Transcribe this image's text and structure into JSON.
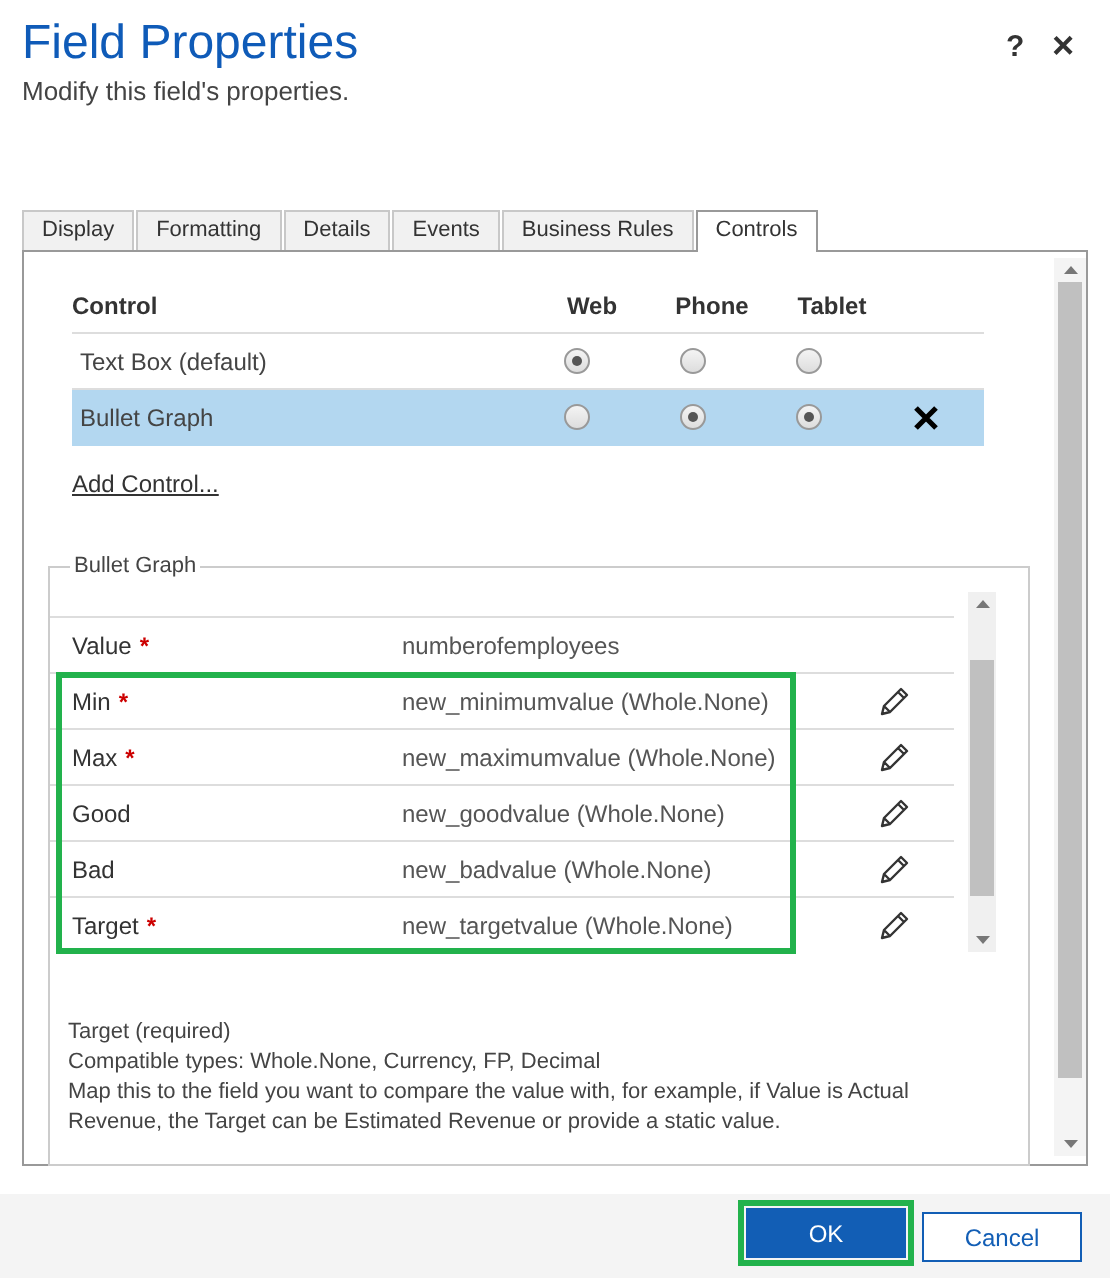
{
  "dialog": {
    "title": "Field Properties",
    "subtitle": "Modify this field's properties.",
    "help_button": "?",
    "close_button": "×"
  },
  "tabs": [
    {
      "label": "Display",
      "selected": false
    },
    {
      "label": "Formatting",
      "selected": false
    },
    {
      "label": "Details",
      "selected": false
    },
    {
      "label": "Events",
      "selected": false
    },
    {
      "label": "Business Rules",
      "selected": false
    },
    {
      "label": "Controls",
      "selected": true
    }
  ],
  "controls_table": {
    "columns": [
      "Control",
      "Web",
      "Phone",
      "Tablet"
    ],
    "rows": [
      {
        "name": "Text Box (default)",
        "selected": false,
        "removable": false,
        "radios": [
          {
            "selected": true
          },
          {
            "selected": false
          },
          {
            "selected": false
          }
        ]
      },
      {
        "name": "Bullet Graph",
        "selected": true,
        "removable": true,
        "radios": [
          {
            "selected": false
          },
          {
            "selected": true
          },
          {
            "selected": true
          }
        ]
      }
    ]
  },
  "add_control_link": "Add Control...",
  "bullet_graph": {
    "legend": "Bullet Graph",
    "properties": [
      {
        "property": "Value",
        "required_mark": "*",
        "value": "numberofemployees",
        "editable": false,
        "highlighted": false
      },
      {
        "property": "Min",
        "required_mark": "*",
        "value": "new_minimumvalue (Whole.None)",
        "editable": true,
        "highlighted": true
      },
      {
        "property": "Max",
        "required_mark": "*",
        "value": "new_maximumvalue (Whole.None)",
        "editable": true,
        "highlighted": true
      },
      {
        "property": "Good",
        "value": "new_goodvalue (Whole.None)",
        "editable": true,
        "highlighted": true
      },
      {
        "property": "Bad",
        "value": "new_badvalue (Whole.None)",
        "editable": true,
        "highlighted": true
      },
      {
        "property": "Target",
        "required_mark": "*",
        "value": "new_targetvalue (Whole.None)",
        "editable": true,
        "highlighted": true
      }
    ],
    "help": [
      "Target (required)",
      "Compatible types: Whole.None, Currency, FP, Decimal",
      "Map this to the field you want to compare the value with, for example, if Value is Actual Revenue, the Target can be Estimated Revenue or provide a static value."
    ]
  },
  "buttons": [
    {
      "label": "OK",
      "kind": "primary",
      "highlighted": true
    },
    {
      "label": "Cancel",
      "kind": "secondary",
      "highlighted": false
    }
  ]
}
